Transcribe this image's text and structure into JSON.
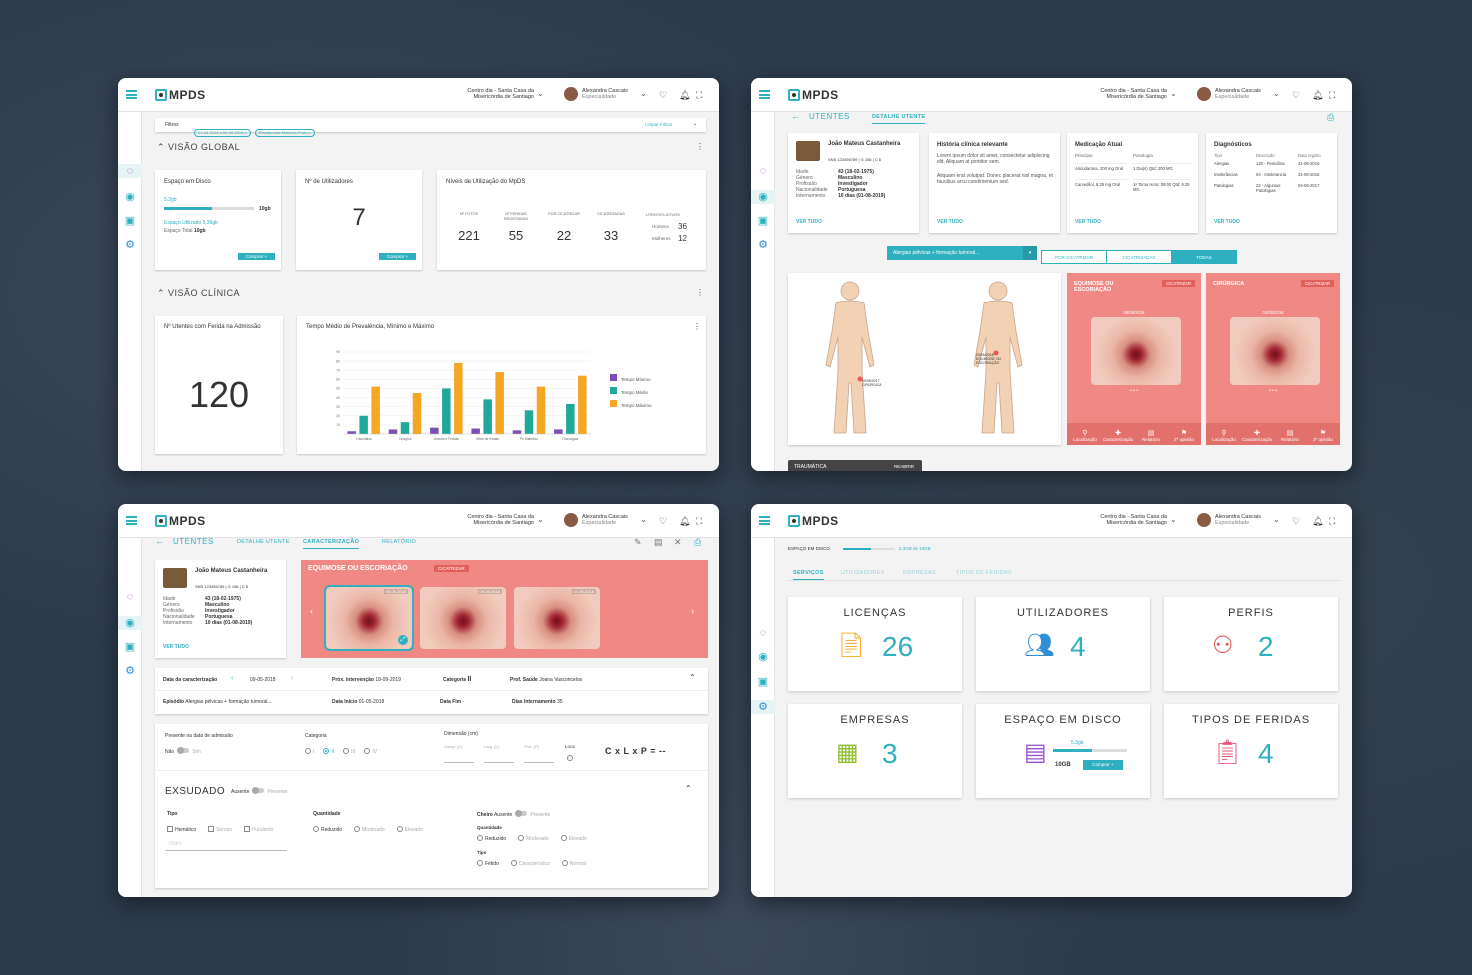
{
  "common": {
    "logo": "MPDS",
    "org_line1": "Centro dia - Santa Casa da",
    "org_line2": "Misericórdia de Santiago",
    "user_name": "Alexandra Cascais",
    "user_role": "Especialidade",
    "accent": "#2fb0c0"
  },
  "w1": {
    "filters_label": "Filtros",
    "filter_tags": [
      "01-08-2019 a 09-08-2019 ×",
      "Residências Moinhos Porto ×"
    ],
    "clear_filters": "Limpar Filtros",
    "section_global": "VISÃO GLOBAL",
    "disk": {
      "title": "Espaço em Disco",
      "used_value": "5.3gb",
      "total_value": "10gb",
      "used_label": "Espaço Utilizado",
      "used": "5.36gb",
      "total_label": "Espaço Total",
      "total": "10gb",
      "button": "Comprar +",
      "fraction": 0.53
    },
    "users": {
      "title": "Nº de Utilizadores",
      "value": "7",
      "button": "Comprar +"
    },
    "usage": {
      "title": "Níveis de Utilização do MpDS",
      "cols": [
        "Nº FOTOS",
        "Nº FERIDAS REGISTADAS",
        "POR CICATRIZAR",
        "CICATRIZADAS"
      ],
      "values": [
        "221",
        "55",
        "22",
        "33"
      ],
      "active_label": "UTENTES ATIVOS",
      "men_label": "Homens",
      "men": "36",
      "women_label": "Mulheres",
      "women": "12"
    },
    "section_clinical": "VISÃO CLÍNICA",
    "admission": {
      "title": "Nº Utentes com Ferida na Admissão",
      "value": "120"
    }
  },
  "chart_data": {
    "type": "bar",
    "title": "Tempo Médio de Prevalência, Mínimo e Máximo",
    "categories": [
      "Traumática",
      "Cirúrgica",
      "Ulceras e Feridas",
      "Mixto de feridas",
      "Pé Diabético",
      "Oncológica"
    ],
    "yticks": [
      "10",
      "20",
      "30",
      "40",
      "50",
      "60",
      "70",
      "80",
      "90"
    ],
    "ylim": [
      0,
      90
    ],
    "series": [
      {
        "name": "Tempo Mínimo",
        "color": "#7b4fb4",
        "values": [
          3,
          5,
          7,
          6,
          4,
          5
        ]
      },
      {
        "name": "Tempo Médio",
        "color": "#20a89a",
        "values": [
          20,
          13,
          50,
          38,
          26,
          33
        ]
      },
      {
        "name": "Tempo Máximo",
        "color": "#f5a623",
        "values": [
          52,
          45,
          78,
          68,
          52,
          64
        ]
      }
    ]
  },
  "w2": {
    "title": "UTENTES",
    "tab": "DETALHE UTENTE",
    "patient": {
      "name": "João Mateus Castanheira",
      "sns": "SNS 123456789 | G 156 | C 5",
      "fields": [
        [
          "Idade",
          "43 (18-02-1975)"
        ],
        [
          "Género",
          "Masculino"
        ],
        [
          "Profissão",
          "Investigador"
        ],
        [
          "Nacionalidade",
          "Portuguesa"
        ],
        [
          "Internamento",
          "10 dias (01-08-2019)"
        ]
      ],
      "link": "VER TUDO"
    },
    "history": {
      "title": "História clínica relevante",
      "text1": "Lorem ipsum dolor sit amet, consectetur adipiscing elit. Aliquam at porttitor sem.",
      "text2": "Aliquam erat volutpat. Donec placerat nisl magna, et faucibus arcu condimentum sed.",
      "link": "VER TUDO"
    },
    "meds": {
      "title": "Medicação Atual",
      "h1": "Princípio",
      "h2": "Posologia",
      "rows": [
        [
          "Amiodarona, 200 mg Oral",
          "1 Dia(s) Qtd: 200 MG"
        ],
        [
          "Carvedilol, 6.25 mg Oral",
          "1ª Toma Hora: 09:00 Qtd: 6.25 MG"
        ]
      ],
      "link": "VER TUDO"
    },
    "diag": {
      "title": "Diagnósticos",
      "h": [
        "Tipo",
        "Descrição",
        "Data registo"
      ],
      "rows": [
        [
          "Alergias",
          "120 - Penicilina",
          "31-08-2016"
        ],
        [
          "Intolerâncias",
          "Int - Intolerancia",
          "31-08-2016"
        ],
        [
          "Patologias",
          "22 - Algumas Patologias",
          "04-08-2017"
        ]
      ],
      "link": "VER TUDO"
    },
    "select": "Alergias pélvicas + formação tumoral...",
    "filters": [
      "POR CICATRIZAR",
      "CICATRIZADAS",
      "TODAS"
    ],
    "body_labels": [
      "09/05/2018 EQUIMOSE OU ESCORIAÇÃO",
      "09/05/2017 CIRÚRGICA"
    ],
    "wound_cards": [
      {
        "title": "EQUIMOSE OU ESCORIAÇÃO",
        "badge": "CICATRIZAR",
        "date": "09/05/2018"
      },
      {
        "title": "CIRÚRGICA",
        "badge": "CICATRIZAR",
        "date": "01/05/2018"
      }
    ],
    "footer_items": [
      "Localização",
      "Caracterização",
      "Relatório",
      "2ª opinião"
    ],
    "bottom_tag": "TRAUMÁTICA",
    "bottom_tag_right": "REABRIR"
  },
  "w3": {
    "title": "UTENTES",
    "tabs": [
      "DETALHE UTENTE",
      "CARACTERIZAÇÃO",
      "RELATÓRIO"
    ],
    "patient": {
      "name": "João Mateus Castanheira",
      "sns": "SNS 123456789 | G 156 | C 5",
      "fields": [
        [
          "Idade",
          "43 (18-02-1975)"
        ],
        [
          "Género",
          "Masculino"
        ],
        [
          "Profissão",
          "Investigador"
        ],
        [
          "Nacionalidade",
          "Portuguesa"
        ],
        [
          "Internamento",
          "10 dias (01-08-2019)"
        ]
      ],
      "link": "VER TUDO"
    },
    "wound_title": "EQUIMOSE OU ESCORIAÇÃO",
    "wound_badge": "CICATRIZAR",
    "thumbs": [
      "09-05-2018",
      "09-05-2018",
      "01-05-2018"
    ],
    "info": {
      "date_label": "Data da caracterização",
      "date": "09-05-2018",
      "next_label": "Próx. intervenção",
      "next": "18-09-2019",
      "cat_label": "Categoria",
      "cat": "II",
      "prof_label": "Prof. Saúde",
      "prof": "Joana Vasconcelos",
      "ep_label": "Episódio",
      "ep": "Alergias pélvicas + formação tumoral...",
      "start_label": "Data Início",
      "start": "01-05-2018",
      "end_label": "Data Fim",
      "end": "-",
      "days_label": "Dias Internamento",
      "days": "35"
    },
    "form": {
      "present_label": "Presente na data de admissão",
      "no": "Não",
      "yes": "Sim",
      "category": "Categoria",
      "cat_opts": [
        "I",
        "II",
        "III",
        "IV"
      ],
      "dim_label": "Dimensão (cm)",
      "dims": [
        "Comp. (C)",
        "Larg. (L)",
        "Prof. (P)"
      ],
      "loca": "Loca",
      "formula": "C x L x P = --"
    },
    "exsudado": {
      "title": "EXSUDADO",
      "absent": "Ausente",
      "present": "Presente",
      "tipo": "Tipo",
      "tipo_opts": [
        "Hemático",
        "Seroso",
        "Purulento"
      ],
      "other": "Outro",
      "qty": "Quantidade",
      "qty_opts": [
        "Reduzido",
        "Moderado",
        "Elevado"
      ],
      "cheiro": "Cheiro",
      "q2": "Quantidade",
      "q2_opts": [
        "Reduzido",
        "Moderado",
        "Elevado"
      ],
      "tipo2": "Tipo",
      "tipo2_opts": [
        "Fétido",
        "Característico",
        "Normal"
      ]
    }
  },
  "w4": {
    "disk_label": "ESPAÇO EM DISCO",
    "disk_value": "5.3GB de 10GB",
    "disk_fraction": 0.53,
    "tabs": [
      "SERVIÇOS",
      "UTILIZADORES",
      "EMPRESAS",
      "TIPOS DE FERIDAS"
    ],
    "tiles": [
      {
        "title": "LICENÇAS",
        "value": "26"
      },
      {
        "title": "UTILIZADORES",
        "value": "4"
      },
      {
        "title": "PERFIS",
        "value": "2"
      },
      {
        "title": "EMPRESAS",
        "value": "3"
      },
      {
        "title": "ESPAÇO EM DISCO",
        "value": "5.3gb",
        "total": "10GB",
        "button": "Comprar +"
      },
      {
        "title": "TIPOS DE FERIDAS",
        "value": "4"
      }
    ]
  }
}
